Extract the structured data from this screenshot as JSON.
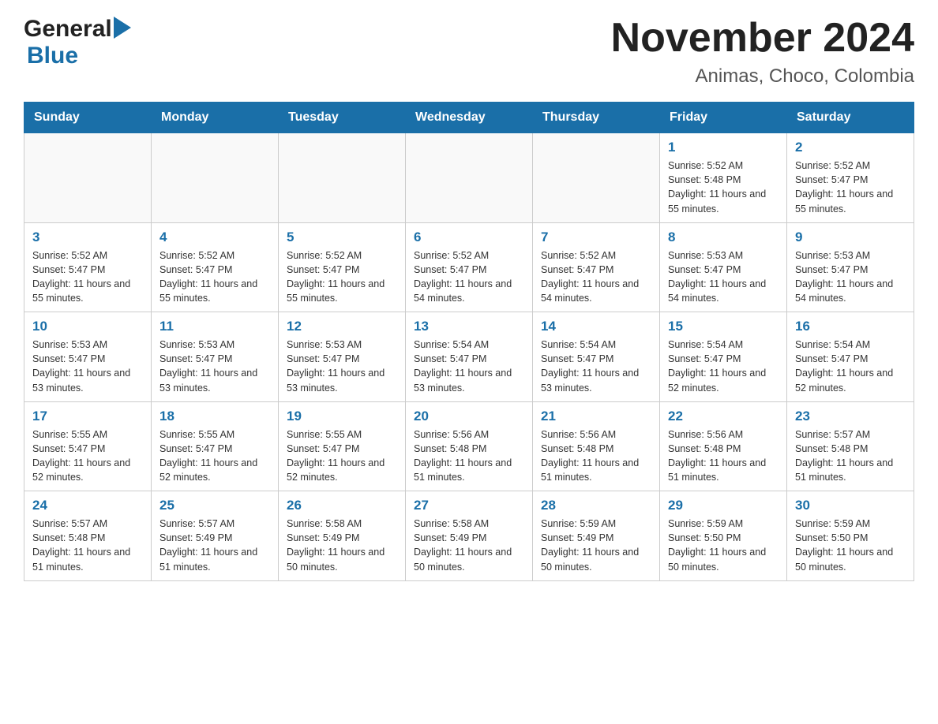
{
  "header": {
    "title": "November 2024",
    "subtitle": "Animas, Choco, Colombia",
    "logo_general": "General",
    "logo_blue": "Blue"
  },
  "days_of_week": [
    "Sunday",
    "Monday",
    "Tuesday",
    "Wednesday",
    "Thursday",
    "Friday",
    "Saturday"
  ],
  "weeks": [
    {
      "days": [
        {
          "num": "",
          "info": ""
        },
        {
          "num": "",
          "info": ""
        },
        {
          "num": "",
          "info": ""
        },
        {
          "num": "",
          "info": ""
        },
        {
          "num": "",
          "info": ""
        },
        {
          "num": "1",
          "info": "Sunrise: 5:52 AM\nSunset: 5:48 PM\nDaylight: 11 hours and 55 minutes."
        },
        {
          "num": "2",
          "info": "Sunrise: 5:52 AM\nSunset: 5:47 PM\nDaylight: 11 hours and 55 minutes."
        }
      ]
    },
    {
      "days": [
        {
          "num": "3",
          "info": "Sunrise: 5:52 AM\nSunset: 5:47 PM\nDaylight: 11 hours and 55 minutes."
        },
        {
          "num": "4",
          "info": "Sunrise: 5:52 AM\nSunset: 5:47 PM\nDaylight: 11 hours and 55 minutes."
        },
        {
          "num": "5",
          "info": "Sunrise: 5:52 AM\nSunset: 5:47 PM\nDaylight: 11 hours and 55 minutes."
        },
        {
          "num": "6",
          "info": "Sunrise: 5:52 AM\nSunset: 5:47 PM\nDaylight: 11 hours and 54 minutes."
        },
        {
          "num": "7",
          "info": "Sunrise: 5:52 AM\nSunset: 5:47 PM\nDaylight: 11 hours and 54 minutes."
        },
        {
          "num": "8",
          "info": "Sunrise: 5:53 AM\nSunset: 5:47 PM\nDaylight: 11 hours and 54 minutes."
        },
        {
          "num": "9",
          "info": "Sunrise: 5:53 AM\nSunset: 5:47 PM\nDaylight: 11 hours and 54 minutes."
        }
      ]
    },
    {
      "days": [
        {
          "num": "10",
          "info": "Sunrise: 5:53 AM\nSunset: 5:47 PM\nDaylight: 11 hours and 53 minutes."
        },
        {
          "num": "11",
          "info": "Sunrise: 5:53 AM\nSunset: 5:47 PM\nDaylight: 11 hours and 53 minutes."
        },
        {
          "num": "12",
          "info": "Sunrise: 5:53 AM\nSunset: 5:47 PM\nDaylight: 11 hours and 53 minutes."
        },
        {
          "num": "13",
          "info": "Sunrise: 5:54 AM\nSunset: 5:47 PM\nDaylight: 11 hours and 53 minutes."
        },
        {
          "num": "14",
          "info": "Sunrise: 5:54 AM\nSunset: 5:47 PM\nDaylight: 11 hours and 53 minutes."
        },
        {
          "num": "15",
          "info": "Sunrise: 5:54 AM\nSunset: 5:47 PM\nDaylight: 11 hours and 52 minutes."
        },
        {
          "num": "16",
          "info": "Sunrise: 5:54 AM\nSunset: 5:47 PM\nDaylight: 11 hours and 52 minutes."
        }
      ]
    },
    {
      "days": [
        {
          "num": "17",
          "info": "Sunrise: 5:55 AM\nSunset: 5:47 PM\nDaylight: 11 hours and 52 minutes."
        },
        {
          "num": "18",
          "info": "Sunrise: 5:55 AM\nSunset: 5:47 PM\nDaylight: 11 hours and 52 minutes."
        },
        {
          "num": "19",
          "info": "Sunrise: 5:55 AM\nSunset: 5:47 PM\nDaylight: 11 hours and 52 minutes."
        },
        {
          "num": "20",
          "info": "Sunrise: 5:56 AM\nSunset: 5:48 PM\nDaylight: 11 hours and 51 minutes."
        },
        {
          "num": "21",
          "info": "Sunrise: 5:56 AM\nSunset: 5:48 PM\nDaylight: 11 hours and 51 minutes."
        },
        {
          "num": "22",
          "info": "Sunrise: 5:56 AM\nSunset: 5:48 PM\nDaylight: 11 hours and 51 minutes."
        },
        {
          "num": "23",
          "info": "Sunrise: 5:57 AM\nSunset: 5:48 PM\nDaylight: 11 hours and 51 minutes."
        }
      ]
    },
    {
      "days": [
        {
          "num": "24",
          "info": "Sunrise: 5:57 AM\nSunset: 5:48 PM\nDaylight: 11 hours and 51 minutes."
        },
        {
          "num": "25",
          "info": "Sunrise: 5:57 AM\nSunset: 5:49 PM\nDaylight: 11 hours and 51 minutes."
        },
        {
          "num": "26",
          "info": "Sunrise: 5:58 AM\nSunset: 5:49 PM\nDaylight: 11 hours and 50 minutes."
        },
        {
          "num": "27",
          "info": "Sunrise: 5:58 AM\nSunset: 5:49 PM\nDaylight: 11 hours and 50 minutes."
        },
        {
          "num": "28",
          "info": "Sunrise: 5:59 AM\nSunset: 5:49 PM\nDaylight: 11 hours and 50 minutes."
        },
        {
          "num": "29",
          "info": "Sunrise: 5:59 AM\nSunset: 5:50 PM\nDaylight: 11 hours and 50 minutes."
        },
        {
          "num": "30",
          "info": "Sunrise: 5:59 AM\nSunset: 5:50 PM\nDaylight: 11 hours and 50 minutes."
        }
      ]
    }
  ]
}
